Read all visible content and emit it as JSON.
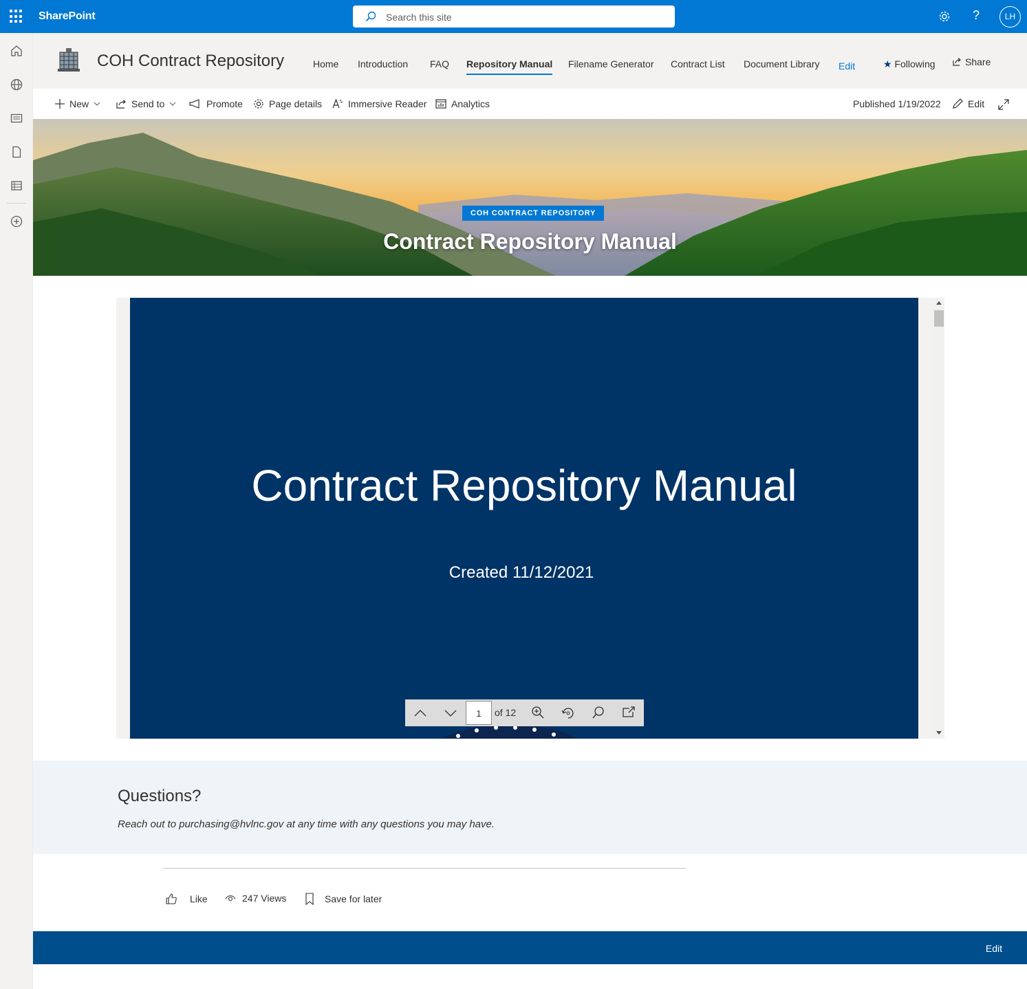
{
  "suite": {
    "brand": "SharePoint",
    "search_placeholder": "Search this site",
    "avatar_initials": "LH",
    "help_label": "?"
  },
  "site": {
    "title": "COH Contract Repository",
    "nav": [
      {
        "label": "Home"
      },
      {
        "label": "Introduction"
      },
      {
        "label": "FAQ"
      },
      {
        "label": "Repository Manual",
        "active": true
      },
      {
        "label": "Filename Generator"
      },
      {
        "label": "Contract List"
      },
      {
        "label": "Document Library"
      }
    ],
    "edit_label": "Edit",
    "following_label": "Following",
    "share_label": "Share"
  },
  "commands": {
    "new": "New",
    "send_to": "Send to",
    "promote": "Promote",
    "page_details": "Page details",
    "immersive_reader": "Immersive Reader",
    "analytics": "Analytics",
    "published": "Published 1/19/2022",
    "edit": "Edit"
  },
  "hero": {
    "tag": "COH CONTRACT REPOSITORY",
    "title": "Contract Repository Manual"
  },
  "document": {
    "slide_title": "Contract Repository Manual",
    "slide_subtitle": "Created 11/12/2021",
    "current_page": "1",
    "page_of": "of 12",
    "colors": {
      "slide_bg": "#003366"
    }
  },
  "questions": {
    "title": "Questions?",
    "text": "Reach out to purchasing@hvlnc.gov at any time with any questions you may have."
  },
  "social": {
    "like": "Like",
    "views": "247 Views",
    "save": "Save for later"
  },
  "footer": {
    "edit": "Edit"
  },
  "colors": {
    "accent": "#0078d4",
    "footer": "#004e8c"
  }
}
